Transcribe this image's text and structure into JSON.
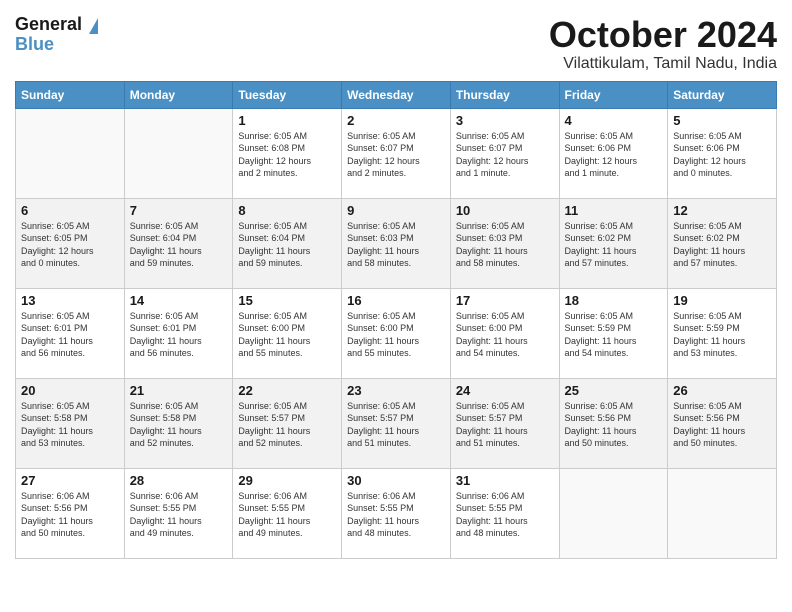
{
  "logo": {
    "general": "General",
    "blue": "Blue"
  },
  "title": "October 2024",
  "subtitle": "Vilattikulam, Tamil Nadu, India",
  "weekdays": [
    "Sunday",
    "Monday",
    "Tuesday",
    "Wednesday",
    "Thursday",
    "Friday",
    "Saturday"
  ],
  "weeks": [
    [
      {
        "day": "",
        "info": ""
      },
      {
        "day": "",
        "info": ""
      },
      {
        "day": "1",
        "info": "Sunrise: 6:05 AM\nSunset: 6:08 PM\nDaylight: 12 hours\nand 2 minutes."
      },
      {
        "day": "2",
        "info": "Sunrise: 6:05 AM\nSunset: 6:07 PM\nDaylight: 12 hours\nand 2 minutes."
      },
      {
        "day": "3",
        "info": "Sunrise: 6:05 AM\nSunset: 6:07 PM\nDaylight: 12 hours\nand 1 minute."
      },
      {
        "day": "4",
        "info": "Sunrise: 6:05 AM\nSunset: 6:06 PM\nDaylight: 12 hours\nand 1 minute."
      },
      {
        "day": "5",
        "info": "Sunrise: 6:05 AM\nSunset: 6:06 PM\nDaylight: 12 hours\nand 0 minutes."
      }
    ],
    [
      {
        "day": "6",
        "info": "Sunrise: 6:05 AM\nSunset: 6:05 PM\nDaylight: 12 hours\nand 0 minutes."
      },
      {
        "day": "7",
        "info": "Sunrise: 6:05 AM\nSunset: 6:04 PM\nDaylight: 11 hours\nand 59 minutes."
      },
      {
        "day": "8",
        "info": "Sunrise: 6:05 AM\nSunset: 6:04 PM\nDaylight: 11 hours\nand 59 minutes."
      },
      {
        "day": "9",
        "info": "Sunrise: 6:05 AM\nSunset: 6:03 PM\nDaylight: 11 hours\nand 58 minutes."
      },
      {
        "day": "10",
        "info": "Sunrise: 6:05 AM\nSunset: 6:03 PM\nDaylight: 11 hours\nand 58 minutes."
      },
      {
        "day": "11",
        "info": "Sunrise: 6:05 AM\nSunset: 6:02 PM\nDaylight: 11 hours\nand 57 minutes."
      },
      {
        "day": "12",
        "info": "Sunrise: 6:05 AM\nSunset: 6:02 PM\nDaylight: 11 hours\nand 57 minutes."
      }
    ],
    [
      {
        "day": "13",
        "info": "Sunrise: 6:05 AM\nSunset: 6:01 PM\nDaylight: 11 hours\nand 56 minutes."
      },
      {
        "day": "14",
        "info": "Sunrise: 6:05 AM\nSunset: 6:01 PM\nDaylight: 11 hours\nand 56 minutes."
      },
      {
        "day": "15",
        "info": "Sunrise: 6:05 AM\nSunset: 6:00 PM\nDaylight: 11 hours\nand 55 minutes."
      },
      {
        "day": "16",
        "info": "Sunrise: 6:05 AM\nSunset: 6:00 PM\nDaylight: 11 hours\nand 55 minutes."
      },
      {
        "day": "17",
        "info": "Sunrise: 6:05 AM\nSunset: 6:00 PM\nDaylight: 11 hours\nand 54 minutes."
      },
      {
        "day": "18",
        "info": "Sunrise: 6:05 AM\nSunset: 5:59 PM\nDaylight: 11 hours\nand 54 minutes."
      },
      {
        "day": "19",
        "info": "Sunrise: 6:05 AM\nSunset: 5:59 PM\nDaylight: 11 hours\nand 53 minutes."
      }
    ],
    [
      {
        "day": "20",
        "info": "Sunrise: 6:05 AM\nSunset: 5:58 PM\nDaylight: 11 hours\nand 53 minutes."
      },
      {
        "day": "21",
        "info": "Sunrise: 6:05 AM\nSunset: 5:58 PM\nDaylight: 11 hours\nand 52 minutes."
      },
      {
        "day": "22",
        "info": "Sunrise: 6:05 AM\nSunset: 5:57 PM\nDaylight: 11 hours\nand 52 minutes."
      },
      {
        "day": "23",
        "info": "Sunrise: 6:05 AM\nSunset: 5:57 PM\nDaylight: 11 hours\nand 51 minutes."
      },
      {
        "day": "24",
        "info": "Sunrise: 6:05 AM\nSunset: 5:57 PM\nDaylight: 11 hours\nand 51 minutes."
      },
      {
        "day": "25",
        "info": "Sunrise: 6:05 AM\nSunset: 5:56 PM\nDaylight: 11 hours\nand 50 minutes."
      },
      {
        "day": "26",
        "info": "Sunrise: 6:05 AM\nSunset: 5:56 PM\nDaylight: 11 hours\nand 50 minutes."
      }
    ],
    [
      {
        "day": "27",
        "info": "Sunrise: 6:06 AM\nSunset: 5:56 PM\nDaylight: 11 hours\nand 50 minutes."
      },
      {
        "day": "28",
        "info": "Sunrise: 6:06 AM\nSunset: 5:55 PM\nDaylight: 11 hours\nand 49 minutes."
      },
      {
        "day": "29",
        "info": "Sunrise: 6:06 AM\nSunset: 5:55 PM\nDaylight: 11 hours\nand 49 minutes."
      },
      {
        "day": "30",
        "info": "Sunrise: 6:06 AM\nSunset: 5:55 PM\nDaylight: 11 hours\nand 48 minutes."
      },
      {
        "day": "31",
        "info": "Sunrise: 6:06 AM\nSunset: 5:55 PM\nDaylight: 11 hours\nand 48 minutes."
      },
      {
        "day": "",
        "info": ""
      },
      {
        "day": "",
        "info": ""
      }
    ]
  ]
}
